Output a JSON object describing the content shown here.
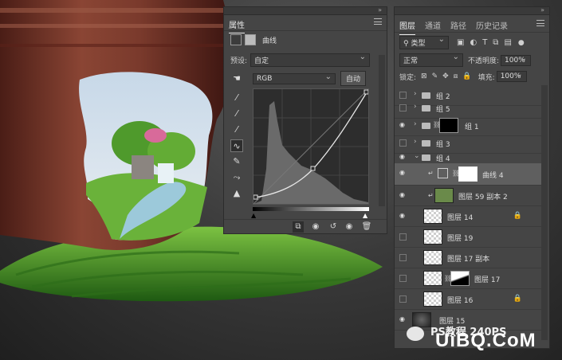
{
  "properties": {
    "tab_label": "属性",
    "adjustment_title": "曲线",
    "preset_label": "预设:",
    "preset_value": "自定",
    "channel_value": "RGB",
    "auto_button": "自动",
    "tools": [
      "hand-adjust-icon",
      "eyedropper-black-icon",
      "eyedropper-gray-icon",
      "eyedropper-white-icon",
      "curve-point-icon",
      "pencil-icon",
      "smooth-icon",
      "clipping-warning-icon"
    ],
    "footer_icons": [
      "clip-to-layer-icon",
      "view-previous-icon",
      "reset-icon",
      "visibility-icon",
      "trash-icon"
    ]
  },
  "layers": {
    "tabs": [
      "图层",
      "通道",
      "路径",
      "历史记录"
    ],
    "filter_kind": "类型",
    "blend_mode": "正常",
    "opacity_label": "不透明度:",
    "opacity_value": "100%",
    "lock_label": "锁定:",
    "fill_label": "填充:",
    "fill_value": "100%",
    "rows": [
      {
        "name": "组 2",
        "visible": false,
        "type": "group"
      },
      {
        "name": "组 5",
        "visible": false,
        "type": "group"
      },
      {
        "name": "组 1",
        "visible": true,
        "type": "group-mask"
      },
      {
        "name": "组 3",
        "visible": false,
        "type": "group"
      },
      {
        "name": "组 4",
        "visible": true,
        "type": "group-open"
      },
      {
        "name": "曲线 4",
        "visible": true,
        "type": "adjustment",
        "selected": true
      },
      {
        "name": "图层 59 副本 2",
        "visible": true,
        "type": "image-clipped"
      },
      {
        "name": "图层 14",
        "visible": true,
        "type": "transparent",
        "locked": true
      },
      {
        "name": "图层 19",
        "visible": false,
        "type": "transparent"
      },
      {
        "name": "图层 17 副本",
        "visible": false,
        "type": "transparent"
      },
      {
        "name": "图层 17",
        "visible": false,
        "type": "mask"
      },
      {
        "name": "图层 16",
        "visible": false,
        "type": "transparent",
        "locked": true
      },
      {
        "name": "图层 15",
        "visible": true,
        "type": "dark"
      }
    ]
  },
  "watermark": {
    "text": "PS教程 240PS",
    "site": "UiBQ.CoM"
  }
}
